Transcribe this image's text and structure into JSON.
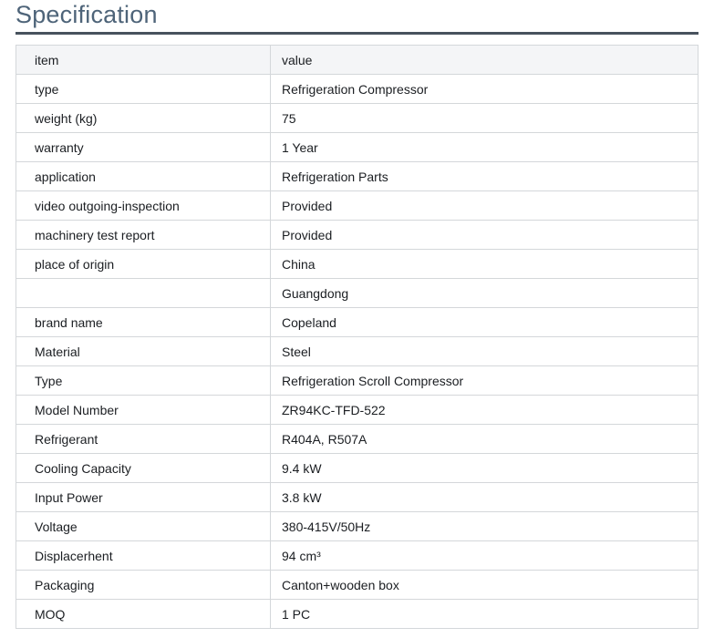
{
  "page": {
    "title": "Specification"
  },
  "colors": {
    "title_text": "#4e6479",
    "title_rule": "#47525d",
    "header_row_bg": "#f4f5f7",
    "table_border": "#d4d7da",
    "cell_text": "#1b1e22"
  },
  "table": {
    "headers": {
      "item": "item",
      "value": "value"
    },
    "rows": [
      {
        "item": "type",
        "value": "Refrigeration Compressor"
      },
      {
        "item": "weight (kg)",
        "value": "75"
      },
      {
        "item": "warranty",
        "value": "1 Year"
      },
      {
        "item": "application",
        "value": "Refrigeration Parts"
      },
      {
        "item": "video outgoing-inspection",
        "value": "Provided"
      },
      {
        "item": "machinery test report",
        "value": "Provided"
      },
      {
        "item": "place of origin",
        "value": "China"
      },
      {
        "item": "",
        "value": "Guangdong"
      },
      {
        "item": "brand name",
        "value": "Copeland"
      },
      {
        "item": "Material",
        "value": "Steel"
      },
      {
        "item": "Type",
        "value": "Refrigeration Scroll Compressor"
      },
      {
        "item": "Model Number",
        "value": "ZR94KC-TFD-522"
      },
      {
        "item": "Refrigerant",
        "value": "R404A, R507A"
      },
      {
        "item": "Cooling Capacity",
        "value": "9.4 kW"
      },
      {
        "item": "Input Power",
        "value": "3.8 kW"
      },
      {
        "item": "Voltage",
        "value": "380-415V/50Hz"
      },
      {
        "item": "Displacerhent",
        "value": "94 cm³"
      },
      {
        "item": "Packaging",
        "value": "Canton+wooden box"
      },
      {
        "item": "MOQ",
        "value": "1 PC"
      }
    ]
  }
}
